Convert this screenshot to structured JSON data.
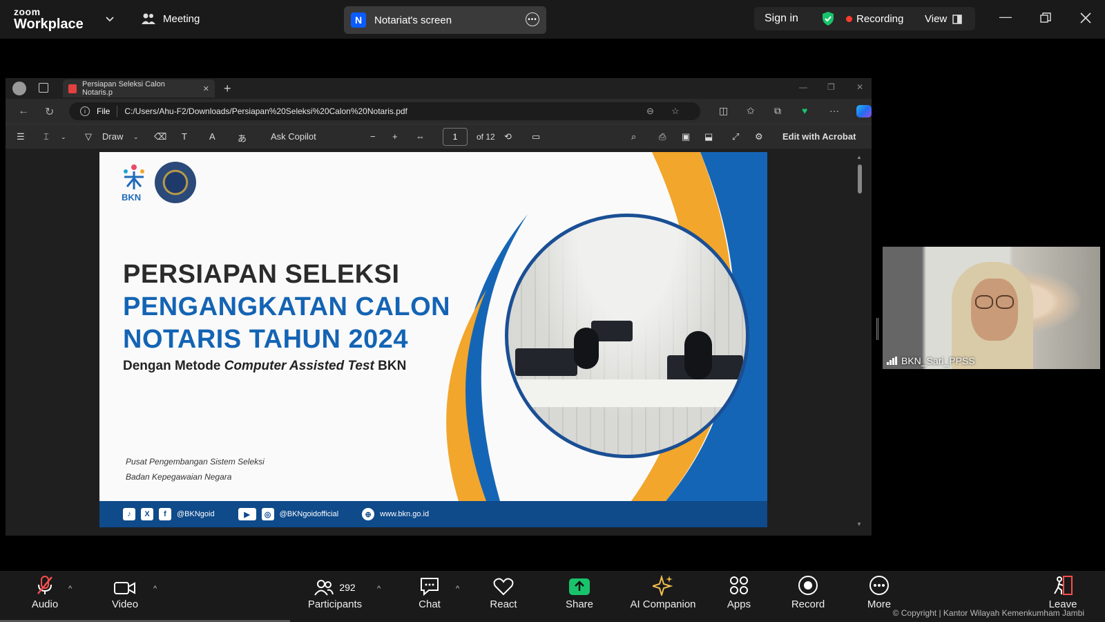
{
  "zoom": {
    "brand_top": "zoom",
    "brand_bottom": "Workplace",
    "meeting_label": "Meeting",
    "screen_initial": "N",
    "screen_label": "Notariat's screen",
    "sign_in": "Sign in",
    "recording": "Recording",
    "view": "View"
  },
  "browser": {
    "tab_title": "Persiapan Seleksi Calon Notaris.p",
    "file_label": "File",
    "url": "C:/Users/Ahu-F2/Downloads/Persiapan%20Seleksi%20Calon%20Notaris.pdf",
    "draw_label": "Draw",
    "ask_copilot": "Ask Copilot",
    "page_current": "1",
    "page_total": "of 12",
    "edit_acrobat": "Edit with Acrobat"
  },
  "slide": {
    "logo_text": "BKN",
    "title_line1": "PERSIAPAN SELEKSI",
    "title_line2": "PENGANGKATAN CALON",
    "title_line3": "NOTARIS TAHUN 2024",
    "subtitle_pre": "Dengan Metode",
    "subtitle_italic": "Computer Assisted Test",
    "subtitle_post": "BKN",
    "footer_line1": "Pusat Pengembangan Sistem Seleksi",
    "footer_line2": "Badan Kepegawaian Negara",
    "social_handle1": "@BKNgoid",
    "social_handle2": "@BKNgoidofficial",
    "website": "www.bkn.go.id"
  },
  "participant": {
    "name": "BKN_Sari_PPSS"
  },
  "toolbar": {
    "audio": "Audio",
    "video": "Video",
    "participants": "Participants",
    "participants_count": "292",
    "chat": "Chat",
    "react": "React",
    "share": "Share",
    "ai_companion": "AI Companion",
    "apps": "Apps",
    "record": "Record",
    "more": "More",
    "leave": "Leave"
  },
  "watermark": "© Copyright | Kantor Wilayah Kemenkumham Jambi",
  "colors": {
    "zoom_blue": "#0b5cff",
    "recording_red": "#ff3b30",
    "share_green": "#19c36b",
    "slide_blue": "#1464b4",
    "slide_orange": "#f2a62c"
  }
}
